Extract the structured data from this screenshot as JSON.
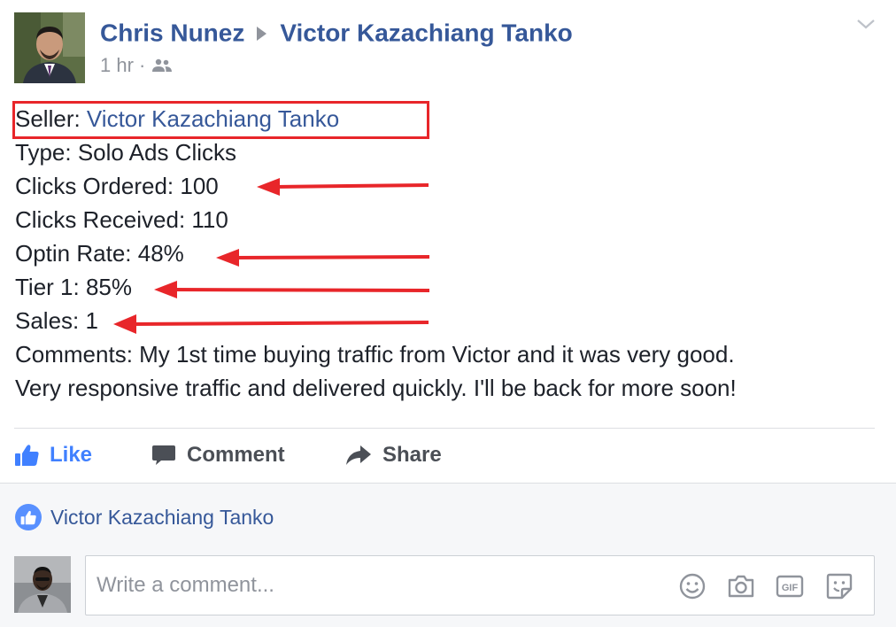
{
  "post": {
    "author": "Chris Nunez",
    "target": "Victor Kazachiang Tanko",
    "time": "1 hr",
    "audience_icon": "friends-icon",
    "lines": {
      "seller_label": "Seller: ",
      "seller_name": "Victor Kazachiang Tanko",
      "type": "Type: Solo Ads Clicks",
      "clicks_ordered": "Clicks Ordered: 100",
      "clicks_received": "Clicks Received: 110",
      "optin_rate": "Optin Rate: 48%",
      "tier1": "Tier 1: 85%",
      "sales": "Sales: 1",
      "comments_1": "Comments: My 1st time buying traffic from Victor and it was very good.",
      "comments_2": "Very responsive traffic and delivered quickly. I'll be back for more soon!"
    },
    "annotation_color": "#e8262a"
  },
  "actions": {
    "like": "Like",
    "comment": "Comment",
    "share": "Share"
  },
  "likes": {
    "name": "Victor Kazachiang Tanko"
  },
  "composer": {
    "placeholder": "Write a comment...",
    "icons": [
      "emoji-icon",
      "camera-icon",
      "gif-icon",
      "sticker-icon"
    ]
  },
  "colors": {
    "link": "#365899",
    "like_blue": "#4080ff",
    "muted": "#90949c"
  }
}
